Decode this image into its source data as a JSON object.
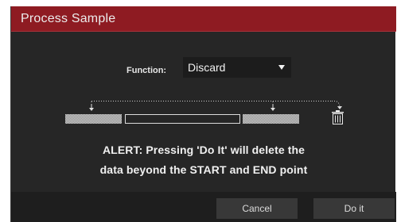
{
  "dialog": {
    "title": "Process Sample",
    "title_bar_color": "#8e1b22"
  },
  "function": {
    "label": "Function:",
    "selected": "Discard"
  },
  "diagram": {
    "icons": [
      "start-marker-icon",
      "end-marker-icon",
      "trash-icon"
    ]
  },
  "alert": {
    "line1": "ALERT: Pressing 'Do It' will delete the",
    "line2": "data beyond the START and END point"
  },
  "buttons": {
    "cancel": "Cancel",
    "do_it": "Do it"
  }
}
